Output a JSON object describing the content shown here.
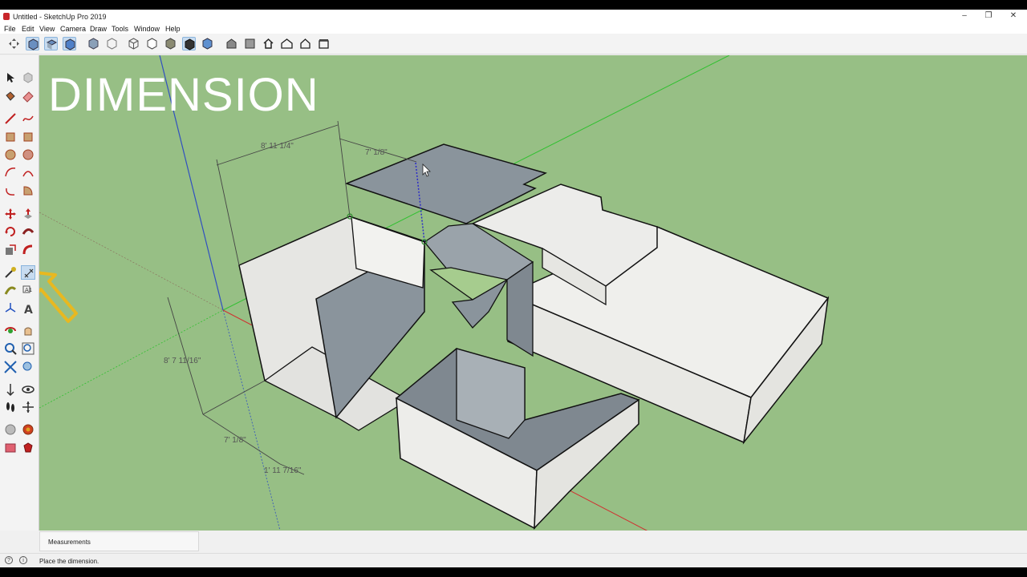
{
  "window": {
    "title": "Untitled - SketchUp Pro 2019",
    "minimize": "–",
    "maximize": "❐",
    "close": "✕"
  },
  "menu": {
    "items": [
      "File",
      "Edit",
      "View",
      "Camera",
      "Draw",
      "Tools",
      "Window",
      "Help"
    ]
  },
  "viewport": {
    "overlay_title": "DIMENSION",
    "background": "#97bf85",
    "dimensions": {
      "d1": "8' 11 1/4\"",
      "d2": "7' 1/8\"",
      "d3": "8' 7 11/16\"",
      "d4": "7' 1/8\"",
      "d5": "1' 11 7/16\""
    }
  },
  "measurements": {
    "label": "Measurements"
  },
  "status": {
    "text": "Place the dimension."
  },
  "colors": {
    "accent_arrow": "#e8b820",
    "axis_red": "#d03030",
    "axis_green": "#30c030",
    "axis_blue": "#3050c0",
    "face_front": "#eeeeea",
    "face_back": "#8a949c"
  }
}
